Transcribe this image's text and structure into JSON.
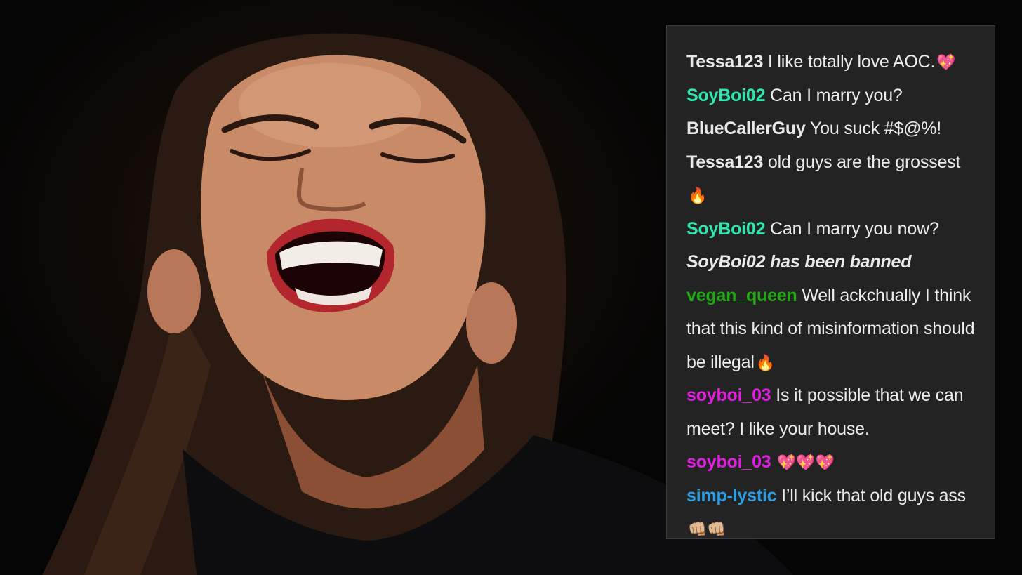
{
  "theme": {
    "panel_bg": "#262626",
    "text_color": "#ececec"
  },
  "photo": {
    "icon": "laughing-woman-photo"
  },
  "chat": {
    "messages": [
      {
        "user": "Tessa123",
        "user_color": "#e8e8e8",
        "text": " I like totally love AOC.",
        "emoji": "💖"
      },
      {
        "user": "SoyBoi02",
        "user_color": "#2ee6b0",
        "text": "  Can I marry you?",
        "emoji": ""
      },
      {
        "user": "BlueCallerGuy",
        "user_color": "#e8e8e8",
        "text": "  You suck #$@%!",
        "emoji": ""
      },
      {
        "user": "Tessa123",
        "user_color": "#e8e8e8",
        "text": "  old guys are the grossest",
        "emoji": "🔥"
      },
      {
        "user": "SoyBoi02",
        "user_color": "#2ee6b0",
        "text": "  Can I marry you now?",
        "emoji": ""
      },
      {
        "system": "SoyBoi02 has been banned"
      },
      {
        "user": "vegan_queen",
        "user_color": "#22a815",
        "text": " Well ackchually I think that this kind of misinformation should be illegal",
        "emoji": "🔥"
      },
      {
        "user": "soyboi_03",
        "user_color": "#e01fe0",
        "text": "  Is it possible that we can meet? I like your house.",
        "emoji": ""
      },
      {
        "user": "soyboi_03",
        "user_color": "#e01fe0",
        "text": "  ",
        "emoji": "💖💖💖"
      },
      {
        "user": "simp-lystic",
        "user_color": "#2b9ee8",
        "text": "  I’ll kick that old guys ass ",
        "emoji": "👊🏼👊🏼"
      }
    ]
  }
}
